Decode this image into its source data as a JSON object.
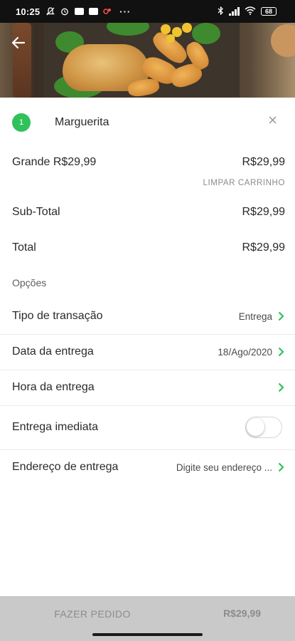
{
  "status_bar": {
    "time": "10:25",
    "battery": "68",
    "left_icons": [
      "notification-icon",
      "alarm-icon",
      "message-icon",
      "chat-icon",
      "app-alert-icon"
    ],
    "more": "···",
    "right_icons": [
      "bluetooth-icon",
      "signal-icon",
      "wifi-icon",
      "battery-icon"
    ]
  },
  "header": {
    "back_icon": "arrow-left-icon"
  },
  "cart": {
    "item": {
      "quantity": "1",
      "name": "Marguerita",
      "remove_icon": "close-icon"
    },
    "item_detail": {
      "label": "Grande R$29,99",
      "price": "R$29,99"
    },
    "clear_cart_label": "LIMPAR CARRINHO",
    "subtotal": {
      "label": "Sub-Total",
      "value": "R$29,99"
    },
    "total": {
      "label": "Total",
      "value": "R$29,99"
    }
  },
  "options": {
    "title": "Opções",
    "transaction_type": {
      "label": "Tipo de transação",
      "value": "Entrega"
    },
    "delivery_date": {
      "label": "Data da entrega",
      "value": "18/Ago/2020"
    },
    "delivery_time": {
      "label": "Hora da entrega",
      "value": ""
    },
    "immediate_delivery": {
      "label": "Entrega imediata",
      "enabled": false
    },
    "delivery_address": {
      "label": "Endereço de entrega",
      "value": "Digite seu endereço ..."
    }
  },
  "footer": {
    "order_button": "FAZER PEDIDO",
    "order_total": "R$29,99"
  },
  "colors": {
    "accent_green": "#2fc25a",
    "footer_bg": "#c9c9c9"
  }
}
